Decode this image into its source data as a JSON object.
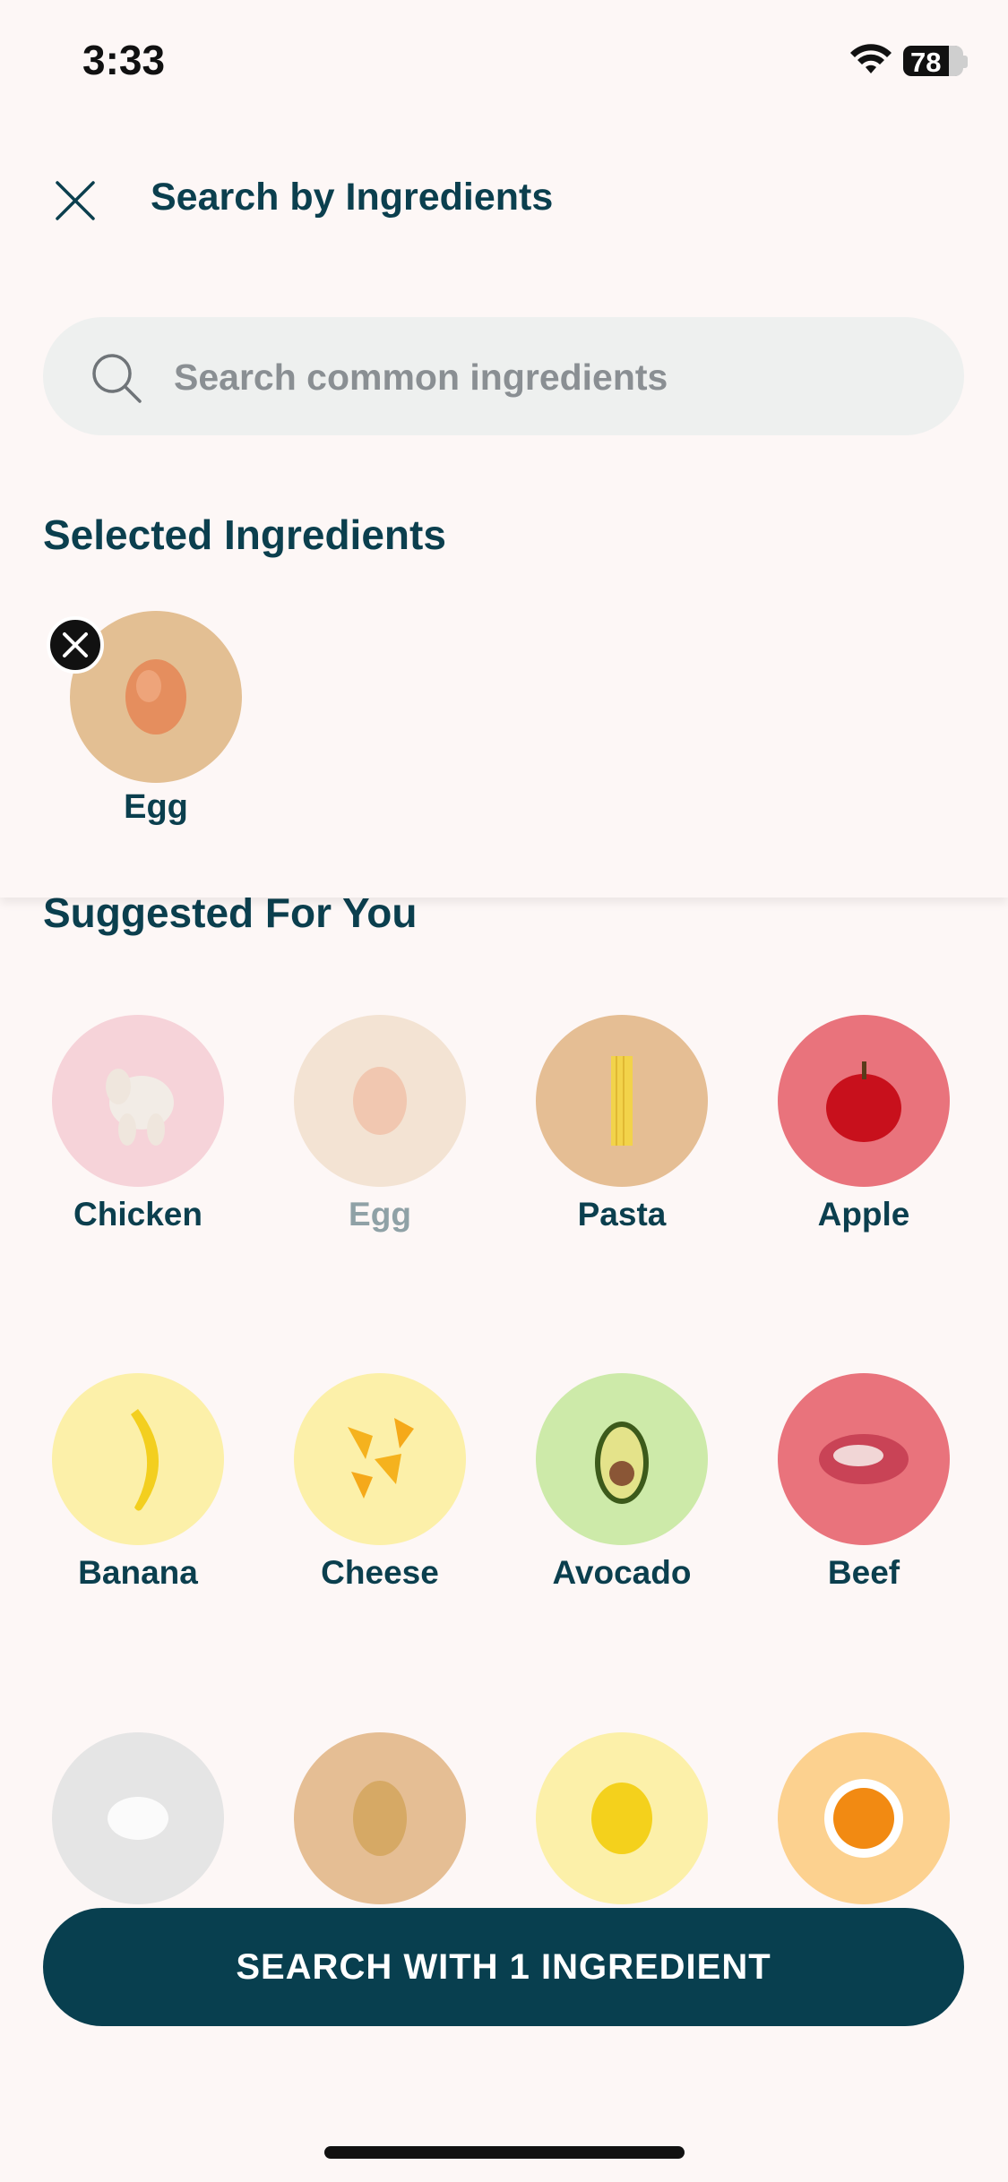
{
  "status": {
    "time": "3:33",
    "battery": "78"
  },
  "header": {
    "title": "Search by Ingredients"
  },
  "search": {
    "placeholder": "Search common ingredients"
  },
  "selected": {
    "title": "Selected Ingredients",
    "items": [
      {
        "label": "Egg",
        "icon": "egg-icon"
      }
    ]
  },
  "suggested": {
    "title": "Suggested For You",
    "items": [
      {
        "label": "Chicken",
        "icon": "chicken-icon",
        "selected": false
      },
      {
        "label": "Egg",
        "icon": "egg-icon",
        "selected": true
      },
      {
        "label": "Pasta",
        "icon": "pasta-icon",
        "selected": false
      },
      {
        "label": "Apple",
        "icon": "apple-icon",
        "selected": false
      },
      {
        "label": "Banana",
        "icon": "banana-icon",
        "selected": false
      },
      {
        "label": "Cheese",
        "icon": "cheese-icon",
        "selected": false
      },
      {
        "label": "Avocado",
        "icon": "avocado-icon",
        "selected": false
      },
      {
        "label": "Beef",
        "icon": "beef-icon",
        "selected": false
      },
      {
        "label": "",
        "icon": "rice-icon",
        "selected": false
      },
      {
        "label": "",
        "icon": "potato-icon",
        "selected": false
      },
      {
        "label": "",
        "icon": "lemon-icon",
        "selected": false
      },
      {
        "label": "",
        "icon": "egg-yolk-icon",
        "selected": false
      }
    ]
  },
  "cta": {
    "label": "SEARCH WITH 1 INGREDIENT"
  },
  "colors": {
    "primary": "#083f4f",
    "background": "#fdf7f6",
    "search_bg": "#eef0ef"
  }
}
